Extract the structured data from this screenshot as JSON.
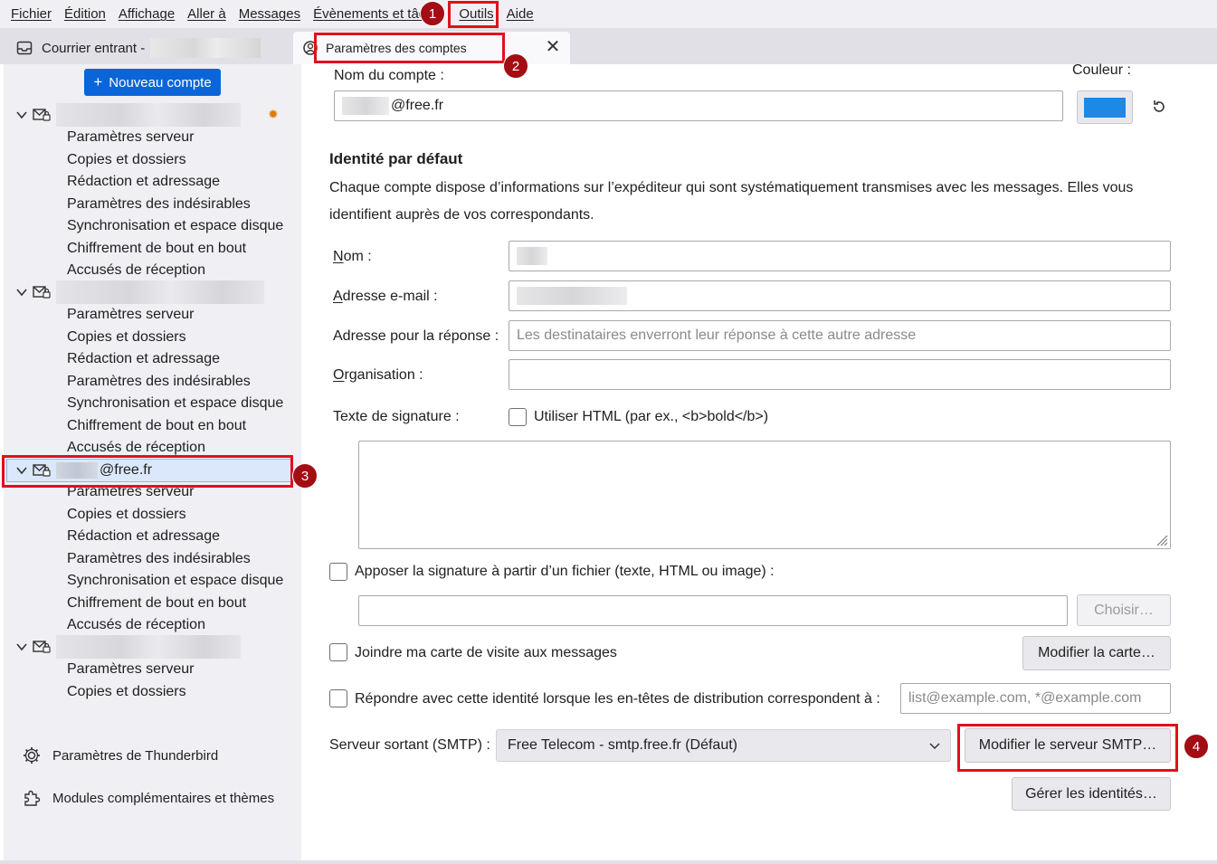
{
  "menubar": {
    "items": [
      "Fichier",
      "Édition",
      "Affichage",
      "Aller à",
      "Messages",
      "Évènements et tâc",
      "Outils",
      "Aide"
    ]
  },
  "tabs": {
    "inbox_label": "Courrier entrant -",
    "settings_label": "Paramètres des comptes"
  },
  "sidebar": {
    "new_account_label": "Nouveau compte",
    "account3_email": "@free.fr",
    "sub_items": [
      "Paramètres serveur",
      "Copies et dossiers",
      "Rédaction et adressage",
      "Paramètres des indésirables",
      "Synchronisation et espace disque",
      "Chiffrement de bout en bout",
      "Accusés de réception"
    ],
    "tb_settings": "Paramètres de Thunderbird",
    "addons": "Modules complémentaires et thèmes"
  },
  "main": {
    "account_name_label": "Nom du compte :",
    "account_name_value": "@free.fr",
    "color_label": "Couleur :",
    "color_value": "#1e88e5",
    "identity_heading": "Identité par défaut",
    "identity_desc": "Chaque compte dispose d’informations sur l’expéditeur qui sont systématiquement transmises avec les messages. Elles vous identifient auprès de vos correspondants.",
    "name_label": "Nom :",
    "email_label": "Adresse e-mail :",
    "reply_label": "Adresse pour la réponse :",
    "reply_placeholder": "Les destinataires enverront leur réponse à cette autre adresse",
    "org_label": "Organisation :",
    "sig_label": "Texte de signature :",
    "html_checkbox": "Utiliser HTML (par ex., <b>bold</b>)",
    "sig_file_checkbox": "Apposer la signature à partir d’un fichier (texte, HTML ou image) :",
    "choose_button": "Choisir…",
    "vcard_checkbox": "Joindre ma carte de visite aux messages",
    "edit_card_button": "Modifier la carte…",
    "reply_identity_checkbox": "Répondre avec cette identité lorsque les en-têtes de distribution correspondent à :",
    "reply_identity_placeholder": "list@example.com, *@example.com",
    "smtp_label": "Serveur sortant (SMTP) :",
    "smtp_value": "Free Telecom - smtp.free.fr (Défaut)",
    "smtp_edit_button": "Modifier le serveur SMTP…",
    "manage_identities_button": "Gérer les identités…"
  },
  "annotations": [
    "1",
    "2",
    "3",
    "4"
  ],
  "colors": {
    "accent": "#0a66d8",
    "annotation_red": "#e0101e",
    "badge": "#a30d14"
  }
}
